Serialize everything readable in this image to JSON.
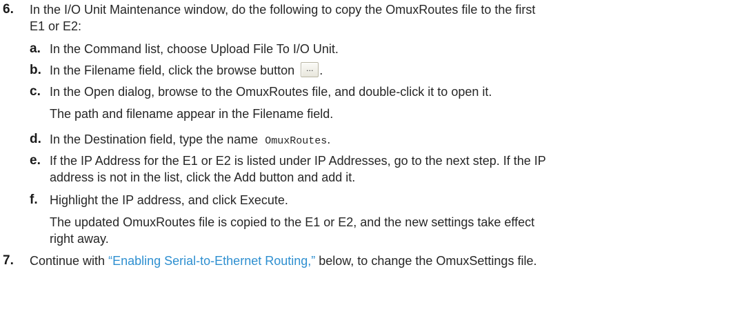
{
  "steps": [
    {
      "number": "6.",
      "text_line1": "In the I/O Unit Maintenance window, do the following to copy the OmuxRoutes file to the first",
      "text_line2": "E1 or E2:",
      "substeps": {
        "a": {
          "letter": "a.",
          "text": "In the Command list, choose Upload File To I/O Unit."
        },
        "b": {
          "letter": "b.",
          "text_before": "In the Filename field, click the browse button",
          "button_label": "...",
          "text_after": "."
        },
        "c": {
          "letter": "c.",
          "text": "In the Open dialog, browse to the OmuxRoutes file, and double-click it to open it.",
          "result": "The path and filename appear in the Filename field."
        },
        "d": {
          "letter": "d.",
          "text_before": "In the Destination field, type the name",
          "code": "OmuxRoutes",
          "text_after": "."
        },
        "e": {
          "letter": "e.",
          "text_line1": "If the IP Address for the E1 or E2 is listed under IP Addresses, go to the next step. If the IP",
          "text_line2": "address is not in the list, click the Add button and add it."
        },
        "f": {
          "letter": "f.",
          "text": "Highlight the IP address, and click Execute.",
          "result_line1": "The updated OmuxRoutes file is copied to the E1 or E2, and the new settings take effect",
          "result_line2": "right away."
        }
      }
    },
    {
      "number": "7.",
      "text_before": "Continue with",
      "link": "“Enabling Serial-to-Ethernet Routing,”",
      "text_after": "below, to change the OmuxSettings file."
    }
  ],
  "colors": {
    "text": "#262626",
    "link": "#2e8fd0"
  }
}
